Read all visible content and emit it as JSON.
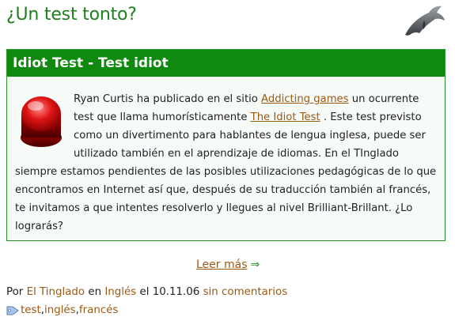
{
  "page": {
    "title": "¿Un test tonto?"
  },
  "post": {
    "header": "Idiot Test - Test idiot",
    "body": {
      "p1": "Ryan Curtis ha publicado en el sitio ",
      "link1": "Addicting games",
      "p2": " un ocurrente test que llama humorísticamente ",
      "link2": "The Idiot Test",
      "p3": " . Este test previsto como un divertimento para hablantes de lengua inglesa, puede ser utilizado también en el aprendizaje de idiomas. En el TInglado siempre estamos pendientes de las posibles utilizaciones pedagógicas de lo que encontramos en Internet así que, después de su traducción también al francés, te invitamos a que intentes resolverlo y llegues al nivel Brilliant-Brillant. ¿Lo lograrás?"
    },
    "read_more": {
      "label": "Leer más",
      "arrow": "⇒"
    },
    "meta": {
      "by": "Por ",
      "author": "El Tinglado",
      "in": " en ",
      "category": "Inglés",
      "date_text": " el 10.11.06 ",
      "comments": "sin comentarios"
    },
    "tags": [
      "test",
      "inglés",
      "francés"
    ],
    "tag_sep": ", "
  },
  "colors": {
    "accent_green": "#0f8a0f",
    "link_brown": "#9a5a14",
    "title_green": "#1d7f1d"
  },
  "icons": [
    "dolphin-logo-icon",
    "red-button-icon",
    "tag-icon",
    "arrow-right-icon"
  ]
}
